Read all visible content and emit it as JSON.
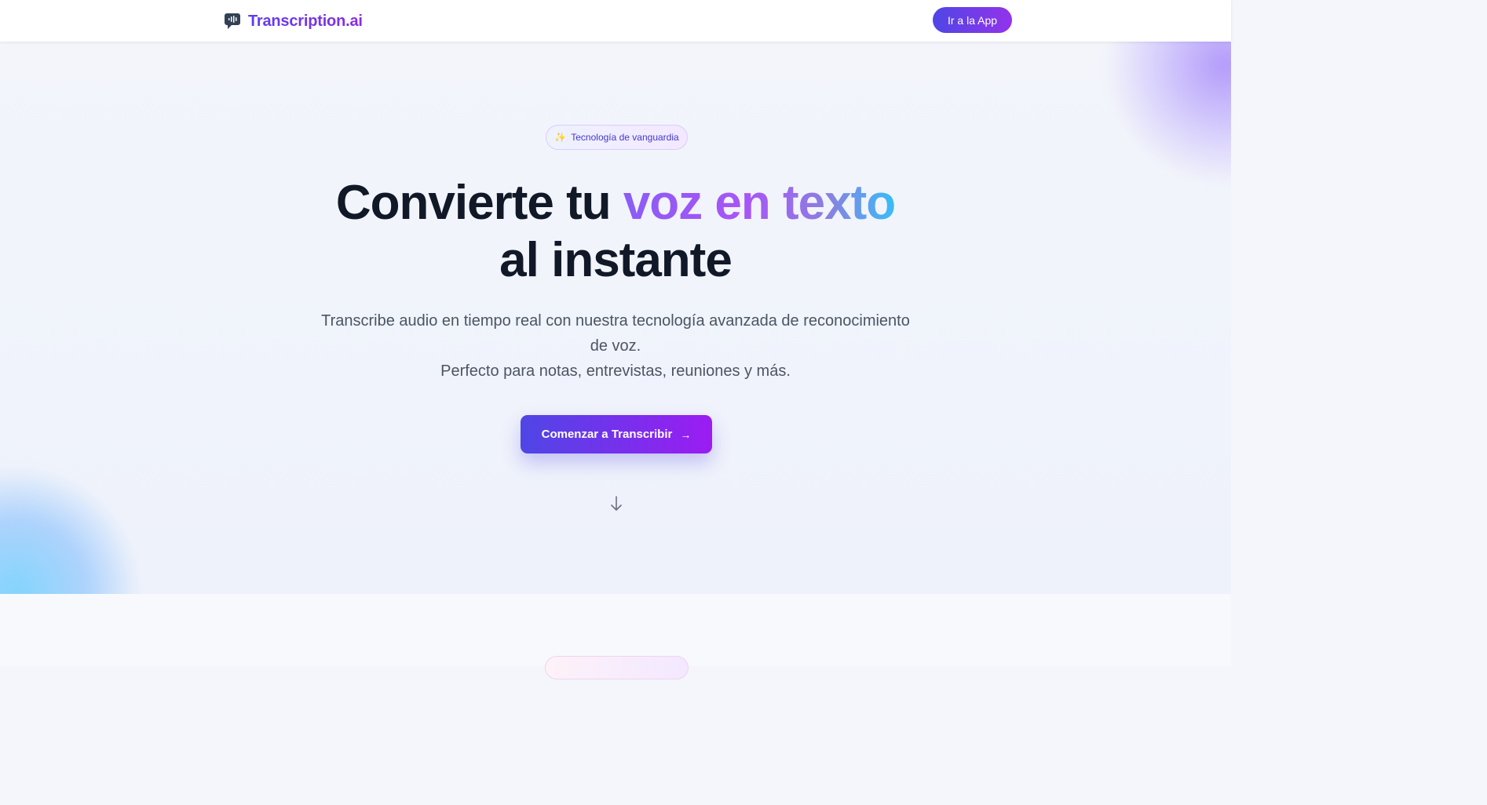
{
  "nav": {
    "brand": "Transcription.ai",
    "cta_label": "Ir a la App"
  },
  "hero": {
    "badge_icon": "✨",
    "badge_label": "Tecnología de vanguardia",
    "headline_part1": "Convierte tu ",
    "headline_highlight": "voz en texto",
    "headline_line2": "al instante",
    "subtitle_line1": "Transcribe audio en tiempo real con nuestra tecnología avanzada de reconocimiento",
    "subtitle_line2": "de voz.",
    "subtitle_line3": "Perfecto para notas, entrevistas, reuniones y más.",
    "cta_label": "Comenzar a Transcribir",
    "cta_icon": "→"
  },
  "colors": {
    "accent_start": "#4f46e5",
    "accent_end": "#9333ea",
    "heading": "#111827",
    "body_text": "#4b5563"
  },
  "icons": {
    "brand": "speech-bubble-waveform-icon",
    "badge": "sparkles-icon",
    "cta": "arrow-right-icon",
    "scroll": "arrow-down-icon"
  }
}
